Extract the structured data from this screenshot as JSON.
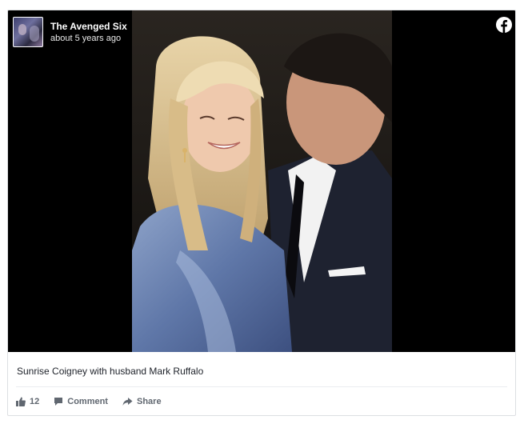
{
  "post": {
    "page_name": "The Avenged Six",
    "time": "about 5 years ago",
    "caption": "Sunrise Coigney with husband Mark Ruffalo"
  },
  "icons": {
    "platform": "facebook-icon",
    "like": "thumbs-up-icon",
    "comment": "comment-icon",
    "share": "share-icon"
  },
  "actions": {
    "like_count": "12",
    "comment_label": "Comment",
    "share_label": "Share"
  },
  "colors": {
    "media_background": "#000000",
    "action_text": "#606770"
  }
}
